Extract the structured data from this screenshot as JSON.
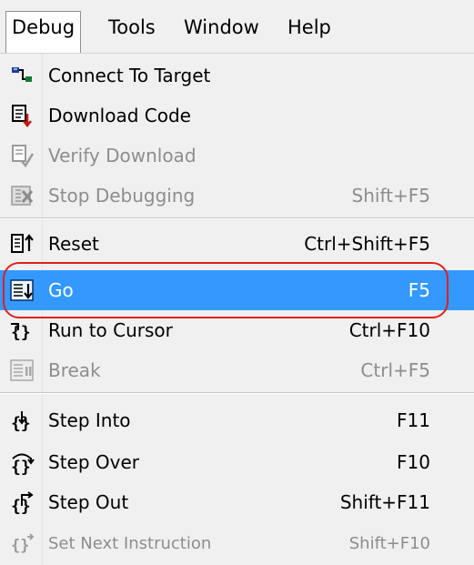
{
  "menubar": {
    "items": [
      {
        "label": "Debug"
      },
      {
        "label": "Tools"
      },
      {
        "label": "Window"
      },
      {
        "label": "Help"
      }
    ]
  },
  "debug_menu": {
    "items": [
      {
        "label": "Connect To Target",
        "shortcut": "",
        "icon": "connect-icon",
        "enabled": true
      },
      {
        "label": "Download Code",
        "shortcut": "",
        "icon": "download-code-icon",
        "enabled": true
      },
      {
        "label": "Verify Download",
        "shortcut": "",
        "icon": "verify-download-icon",
        "enabled": false
      },
      {
        "label": "Stop Debugging",
        "shortcut": "Shift+F5",
        "icon": "stop-debugging-icon",
        "enabled": false
      },
      {
        "label": "Reset",
        "shortcut": "Ctrl+Shift+F5",
        "icon": "reset-icon",
        "enabled": true
      },
      {
        "label": "Go",
        "shortcut": "F5",
        "icon": "go-icon",
        "enabled": true,
        "highlighted": true
      },
      {
        "label": "Run to Cursor",
        "shortcut": "Ctrl+F10",
        "icon": "run-to-cursor-icon",
        "enabled": true
      },
      {
        "label": "Break",
        "shortcut": "Ctrl+F5",
        "icon": "break-icon",
        "enabled": false
      },
      {
        "label": "Step Into",
        "shortcut": "F11",
        "icon": "step-into-icon",
        "enabled": true
      },
      {
        "label": "Step Over",
        "shortcut": "F10",
        "icon": "step-over-icon",
        "enabled": true
      },
      {
        "label": "Step Out",
        "shortcut": "Shift+F11",
        "icon": "step-out-icon",
        "enabled": true
      },
      {
        "label": "Set Next Instruction",
        "shortcut": "Shift+F10",
        "icon": "set-next-instruction-icon",
        "enabled": false
      }
    ]
  },
  "colors": {
    "highlight": "#3399ff",
    "callout": "#e02020",
    "disabled_text": "#8d8d8d",
    "menu_background": "#f0f0f0"
  }
}
